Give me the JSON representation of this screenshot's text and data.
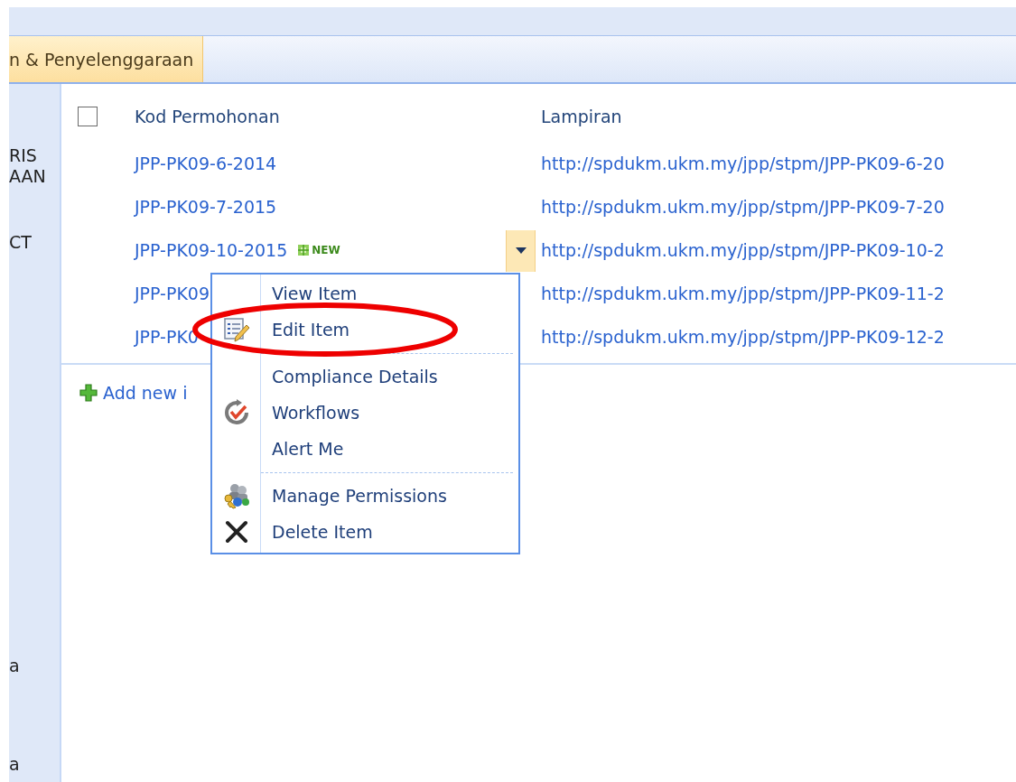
{
  "ribbon": {
    "tabs": [
      {
        "label": "n & Penyelenggaraan",
        "selected": true
      }
    ]
  },
  "sidebar": {
    "items": [
      {
        "lines": [
          "RIS",
          "AAN"
        ]
      },
      {
        "lines": [
          "CT"
        ]
      },
      {
        "lines": [
          "a"
        ]
      },
      {
        "lines": [
          "a"
        ]
      }
    ]
  },
  "list": {
    "select_all": {
      "checked": false
    },
    "columns": [
      {
        "label": "Kod Permohonan"
      },
      {
        "label": "Lampiran"
      }
    ],
    "rows": [
      {
        "code": "JPP-PK09-6-2014",
        "attachment": "http://spdukm.ukm.my/jpp/stpm/JPP-PK09-6-20",
        "menu_open": false
      },
      {
        "code": "JPP-PK09-7-2015",
        "attachment": "http://spdukm.ukm.my/jpp/stpm/JPP-PK09-7-20",
        "menu_open": false
      },
      {
        "code": "JPP-PK09-10-2015",
        "badge": "NEW",
        "attachment": "http://spdukm.ukm.my/jpp/stpm/JPP-PK09-10-2",
        "menu_open": true
      },
      {
        "code": "JPP-PK09",
        "attachment": "http://spdukm.ukm.my/jpp/stpm/JPP-PK09-11-2",
        "menu_open": false
      },
      {
        "code": "JPP-PK0",
        "attachment": "http://spdukm.ukm.my/jpp/stpm/JPP-PK09-12-2",
        "menu_open": false
      }
    ],
    "add_new": "Add new i"
  },
  "context_menu": {
    "groups": [
      {
        "items": [
          {
            "label": "View Item",
            "kind": "plain",
            "circled": false
          },
          {
            "label": "Edit Item",
            "kind": "edit",
            "circled": true
          }
        ]
      },
      {
        "items": [
          {
            "label": "Compliance Details",
            "kind": "plain",
            "circled": false
          },
          {
            "label": "Workflows",
            "kind": "workflow",
            "circled": false
          },
          {
            "label": "Alert Me",
            "kind": "plain",
            "circled": false
          }
        ]
      },
      {
        "items": [
          {
            "label": "Manage Permissions",
            "kind": "permissions",
            "circled": false
          },
          {
            "label": "Delete Item",
            "kind": "delete",
            "circled": false
          }
        ]
      }
    ]
  }
}
